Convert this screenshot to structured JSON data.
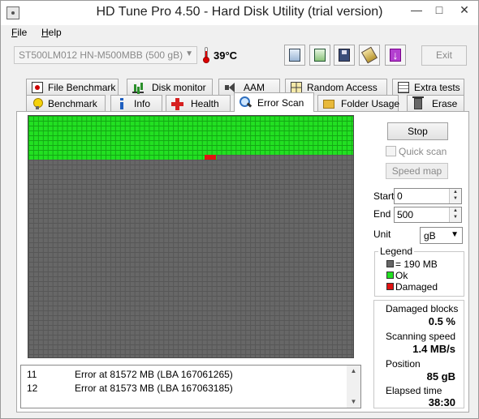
{
  "window": {
    "title": "HD Tune Pro 4.50 - Hard Disk Utility (trial version)",
    "controls": {
      "minimize": "—",
      "maximize": "□",
      "close": "✕"
    }
  },
  "menu": [
    {
      "hotkey": "F",
      "rest": "ile"
    },
    {
      "hotkey": "H",
      "rest": "elp"
    }
  ],
  "toolbar": {
    "disk": "ST500LM012 HN-M500MBB (500 gB)",
    "temperature": "39°C",
    "exit_label": "Exit",
    "icons": [
      "copy-icon",
      "copy-all-icon",
      "save-icon",
      "screenshot-icon",
      "download-icon"
    ],
    "download_glyph": "↓"
  },
  "tabs": {
    "row1": [
      "File Benchmark",
      "Disk monitor",
      "AAM",
      "Random Access",
      "Extra tests"
    ],
    "row2": [
      "Benchmark",
      "Info",
      "Health",
      "Error Scan",
      "Folder Usage",
      "Erase"
    ],
    "active": "Error Scan"
  },
  "scan": {
    "scanned_fraction": 0.17,
    "colors": {
      "ok": "#22e022",
      "damaged": "#e11212",
      "untested": "#676767"
    }
  },
  "controls": {
    "stop_label": "Stop",
    "quick_scan_label": "Quick scan",
    "quick_scan_checked": false,
    "speed_map_label": "Speed map",
    "start_label": "Start",
    "start_value": "0",
    "end_label": "End",
    "end_value": "500",
    "unit_label": "Unit",
    "unit_value": "gB"
  },
  "legend": {
    "title": "Legend",
    "block": "= 190 MB",
    "ok": "Ok",
    "damaged": "Damaged"
  },
  "stats": {
    "damaged_blocks_label": "Damaged blocks",
    "damaged_blocks_value": "0.5 %",
    "scanning_speed_label": "Scanning speed",
    "scanning_speed_value": "1.4 MB/s",
    "position_label": "Position",
    "position_value": "85 gB",
    "elapsed_label": "Elapsed time",
    "elapsed_value": "38:30"
  },
  "log": [
    {
      "num": "11",
      "msg": "Error at 81572 MB (LBA 167061265)"
    },
    {
      "num": "12",
      "msg": "Error at 81573 MB (LBA 167063185)"
    }
  ]
}
